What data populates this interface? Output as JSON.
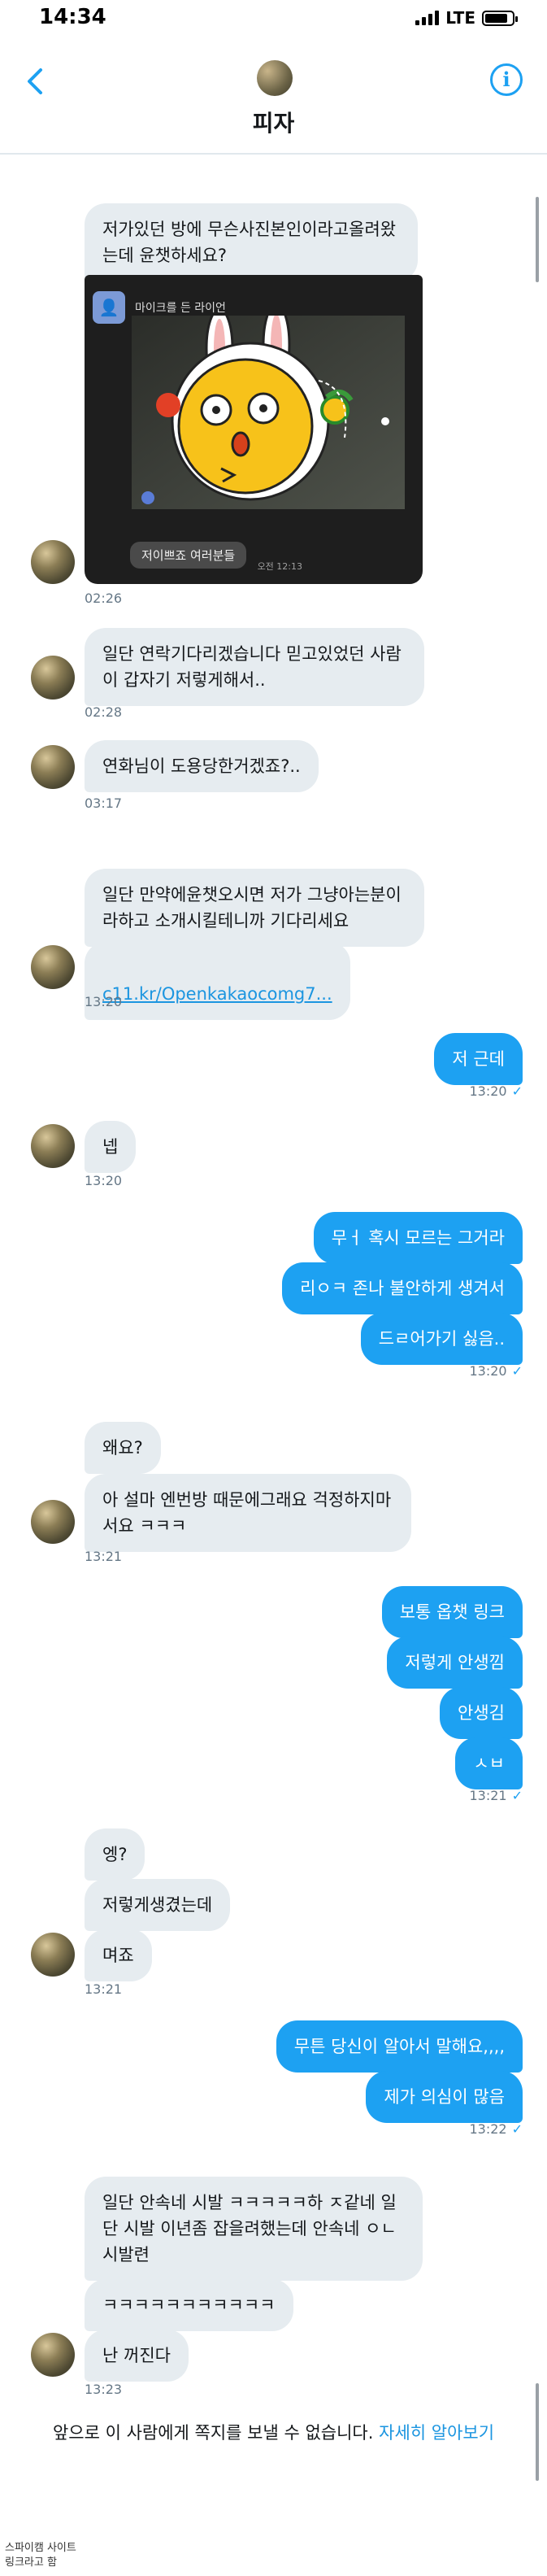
{
  "status": {
    "time": "14:34",
    "network": "LTE",
    "battery_level": 0.85
  },
  "header": {
    "title": "피자",
    "back_icon": "chevron-left-icon",
    "info_icon": "info-icon",
    "accent": "#1da1f2"
  },
  "colors": {
    "incoming_bubble": "#e6ecf0",
    "outgoing_bubble": "#1da1f2",
    "text_secondary": "#657786"
  },
  "messages": {
    "m1": "저가있던 방에 무슨사진본인이라고올려왔는데 윤챗하세요?",
    "attachment": {
      "sender": "마이크를 든 라이언",
      "caption": "저이쁘죠 여러분들",
      "time": "오전 12:13"
    },
    "t1": "02:26",
    "m2": "일단 연락기다리겠습니다 믿고있었던 사람이 갑자기 저렇게해서..",
    "t2": "02:28",
    "m3": "연화님이 도용당한거겠죠?..",
    "t3": "03:17",
    "m4": "일단 만약에윤챗오시면 저가 그냥아는분이라하고 소개시킬테니까 기다리세요",
    "m4_link": "c11.kr/Openkakaocomg7...",
    "t4": "13:20",
    "o1": "저 근데",
    "t5": "13:20",
    "m5": "넵",
    "t6": "13:20",
    "o2": "무ㅓ 혹시 모르는 그거라",
    "o3": "리ㅇㅋ 존나 불안하게 생겨서",
    "o4": "드ㄹ어가기 싫음..",
    "t7": "13:20",
    "m6": "왜요?",
    "m7": "아 설마 엔번방 때문에그래요 걱정하지마서요 ㅋㅋㅋ",
    "t8": "13:21",
    "o5": "보통 옵챗 링크",
    "o6": "저렇게 안생낌",
    "o7": "안생김",
    "o8": "ㅅㅂ",
    "t9": "13:21",
    "m8": "엥?",
    "m9": "저렇게생겼는데",
    "m10": "며죠",
    "t10": "13:21",
    "o9": "무튼 당신이 알아서 말해요,,,,",
    "o10": "제가 의심이 많음",
    "t11": "13:22",
    "m11": "일단 안속네 시발 ㅋㅋㅋㅋㅋ하 ㅈ같네 일단 시발 이년좀 잡을려했는데 안속네 ㅇㄴ 시발련",
    "m12": "ㅋㅋㅋㅋㅋㅋㅋㅋㅋㅋㅋ",
    "m13": "난 꺼진다",
    "t12": "13:23"
  },
  "notice": {
    "text": "앞으로 이 사람에게 쪽지를 보낼 수 없습니다.",
    "learn_more": "자세히 알아보기"
  },
  "footer": {
    "line1": "스파이캠 사이트",
    "line2": "링크라고 함"
  }
}
